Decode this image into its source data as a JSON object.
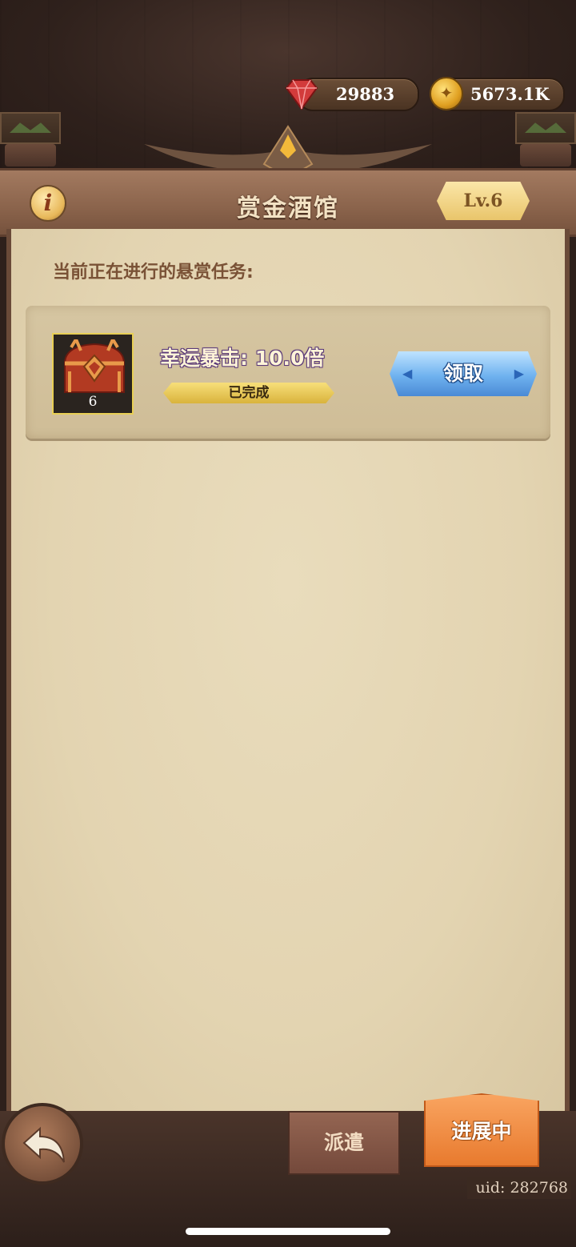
{
  "currency": {
    "gems": "29883",
    "gold": "5673.1K"
  },
  "header": {
    "title": "赏金酒馆",
    "info_icon": "i",
    "level": "Lv.6"
  },
  "panel": {
    "label": "当前正在进行的悬赏任务:"
  },
  "bounty": {
    "name": "幸运暴击: 10.0倍",
    "chest_count": "6",
    "status": "已完成",
    "claim_label": "领取"
  },
  "bottom": {
    "dispatch_tab": "派遣",
    "progress_tab": "进展中",
    "uid": "uid: 282768"
  },
  "icons": {
    "gem": "gem-icon",
    "gold": "gold-coin-icon",
    "info": "info-icon",
    "chest": "treasure-chest-icon",
    "back": "back-arrow-icon"
  },
  "colors": {
    "accent_gold": "#e9c56b",
    "claim_blue": "#6fb2ef",
    "active_tab_orange": "#f9a460",
    "parchment": "#e3d4b1"
  }
}
